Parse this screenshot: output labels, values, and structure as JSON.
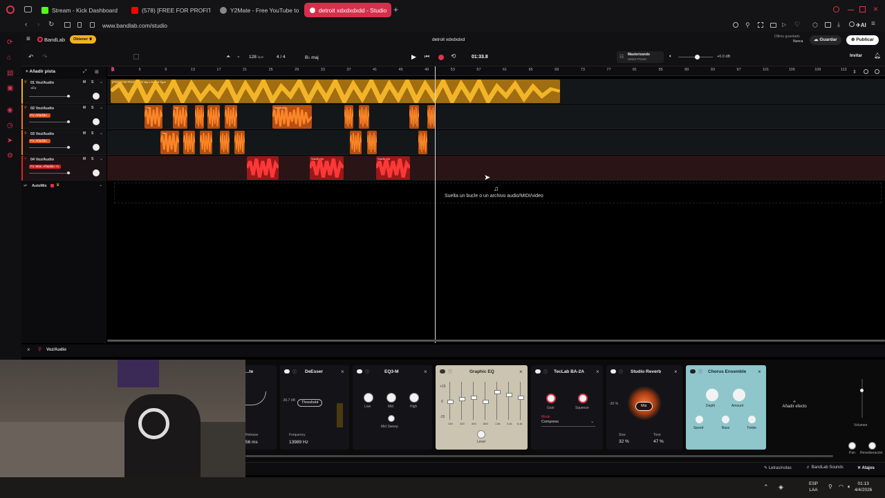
{
  "browser": {
    "tabs": [
      {
        "label": "Stream - Kick Dashboard",
        "icon": "kick-icon",
        "active": false
      },
      {
        "label": "(578) [FREE FOR PROFIT]",
        "icon": "youtube-icon",
        "active": false
      },
      {
        "label": "Y2Mate - Free YouTube to",
        "icon": "y2mate-icon",
        "active": false
      },
      {
        "label": "detroit xdxdxdxdd - Studio",
        "icon": "bandlab-icon",
        "active": true
      }
    ],
    "url": "www.bandlab.com/studio",
    "ai_label": "AI"
  },
  "app": {
    "brand": "BandLab",
    "get_button": "Obtener",
    "project_title": "detroit xdxdxdxd",
    "saved_label": "Último guardado",
    "saved_value": "Nunca",
    "save_button": "Guardar",
    "publish_button": "Publicar",
    "invite_button": "Invitar",
    "accent": "#e0334f"
  },
  "transport": {
    "bpm": "128",
    "bpm_unit": "bpm",
    "time_sig": "4 / 4",
    "key": "B♭ maj",
    "time": "01:33.8",
    "mastering_title": "Masterizando",
    "mastering_sub": "Select Preset",
    "master_db": "+0.0 dB"
  },
  "tracks_panel": {
    "add_track": "Añadir pista",
    "automix": "AutoMix",
    "tracks": [
      {
        "num": "01",
        "name": "Voz/Audio",
        "fx": "+Fx",
        "color": "#f0b020"
      },
      {
        "num": "02",
        "name": "Voz/Audio",
        "fx": "Fx: Añadido",
        "color": "#f07a20"
      },
      {
        "num": "03",
        "name": "Voz/Audio",
        "fx": "Fx: Añadido",
        "color": "#f07a20"
      },
      {
        "num": "04",
        "name": "Voz/Audio",
        "fx": "Fx: Mas. Añadido +1",
        "color": "#e02424"
      }
    ],
    "mute_label": "M",
    "solo_label": "S"
  },
  "ruler": [
    "1",
    "5",
    "9",
    "13",
    "17",
    "21",
    "25",
    "29",
    "33",
    "37",
    "41",
    "45",
    "49",
    "53",
    "57",
    "61",
    "65",
    "69",
    "73",
    "77",
    "81",
    "85",
    "89",
    "93",
    "97",
    "101",
    "105",
    "109",
    "113"
  ],
  "clips": {
    "track1_label": "[FREE FOR PROFIT] YN Jay x Detroit Type",
    "vocal_label": "Voz/Audio",
    "voz_label": "Voz..."
  },
  "drop_hint": "Suelta un bucle o un archivo audio/MIDI/video",
  "bottom_track_label": "Voz/Audio",
  "effects": {
    "partial_title": "...te",
    "partial_value": "56 ms",
    "partial_label": "Release",
    "deesser": {
      "title": "DeEsser",
      "threshold": "Threshold",
      "db": "-36.7 dB",
      "freq_label": "Frequency",
      "freq_value": "13989 Hz"
    },
    "eq3": {
      "title": "EQ3-M",
      "low": "Low",
      "mid": "Mid",
      "high": "High",
      "sweep": "Mid Sweep"
    },
    "graphic_eq": {
      "title": "Graphic EQ",
      "bands": [
        "100",
        "200",
        "400",
        "800",
        "1.6k",
        "3.2k",
        "6.4k"
      ],
      "scale_top": "+15",
      "scale_zero": "0",
      "scale_bot": "-15",
      "level": "Level"
    },
    "teclab": {
      "title": "TecLab BA-2A",
      "gain": "Gain",
      "squeeze": "Squeeze",
      "mode_label": "Mode",
      "mode": "Compress"
    },
    "reverb": {
      "title": "Studio Reverb",
      "mix": "Mix",
      "db": "-36 %",
      "size_label": "Size",
      "size": "32 %",
      "tone_label": "Tone",
      "tone": "47 %"
    },
    "chorus": {
      "title": "Chorus Ensemble",
      "depth": "Depth",
      "amount": "Amount",
      "speed": "Speed",
      "bass": "Bass",
      "treble": "Treble"
    },
    "add_effect": "Añadir efecto",
    "volume": "Volumen",
    "pan": "Pan",
    "reverb_send": "Reverberación"
  },
  "statusbar": {
    "lyrics": "Letras/notas",
    "sounds": "BandLab Sounds",
    "shortcuts": "Atajos"
  },
  "taskbar": {
    "lang1": "ESP",
    "lang2": "LAA",
    "time": "01:13",
    "date": "4/4/2026"
  }
}
